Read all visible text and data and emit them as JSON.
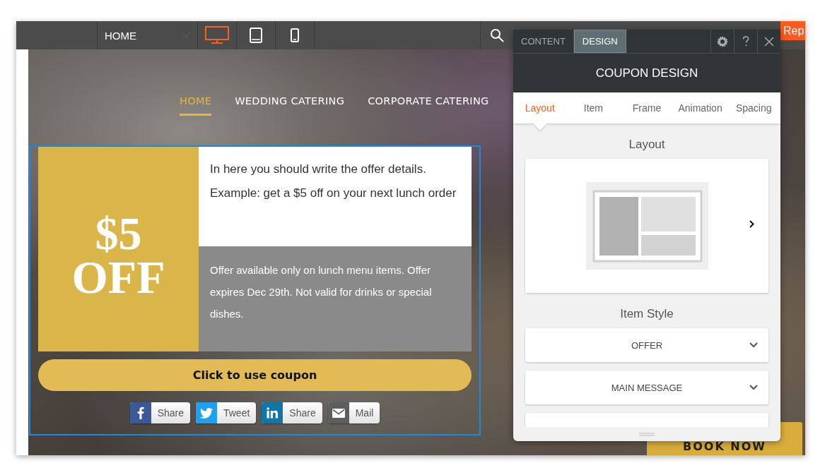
{
  "toolbar": {
    "page_select": {
      "value": "HOME"
    },
    "devices": [
      {
        "kind": "desktop",
        "selected": true
      },
      {
        "kind": "tablet",
        "selected": false
      },
      {
        "kind": "phone",
        "selected": false
      }
    ],
    "action_button": "Rep"
  },
  "site": {
    "nav": [
      {
        "label": "HOME",
        "selected": true
      },
      {
        "label": "WEDDING CATERING",
        "selected": false
      },
      {
        "label": "CORPORATE CATERING",
        "selected": false
      }
    ],
    "coupon": {
      "amount": "$5",
      "suffix": "OFF",
      "details": [
        "In here you should write the offer details.",
        "Example: get a $5 off on your next lunch order"
      ],
      "terms": "Offer available only on lunch menu items. Offer expires Dec 29th. Not valid for drinks or special dishes.",
      "button": "Click to use coupon",
      "share": [
        {
          "kind": "facebook",
          "label": "Share"
        },
        {
          "kind": "twitter",
          "label": "Tweet"
        },
        {
          "kind": "linkedin",
          "label": "Share"
        },
        {
          "kind": "mail",
          "label": "Mail"
        }
      ]
    },
    "book_button": "BOOK NOW"
  },
  "panel": {
    "tabs": [
      {
        "label": "CONTENT",
        "selected": false
      },
      {
        "label": "DESIGN",
        "selected": true
      }
    ],
    "title": "COUPON DESIGN",
    "subtabs": [
      {
        "label": "Layout",
        "selected": true
      },
      {
        "label": "Item",
        "selected": false
      },
      {
        "label": "Frame",
        "selected": false
      },
      {
        "label": "Animation",
        "selected": false
      },
      {
        "label": "Spacing",
        "selected": false
      }
    ],
    "layout_heading": "Layout",
    "style_heading": "Item Style",
    "style_items": [
      "OFFER",
      "MAIN MESSAGE"
    ]
  }
}
